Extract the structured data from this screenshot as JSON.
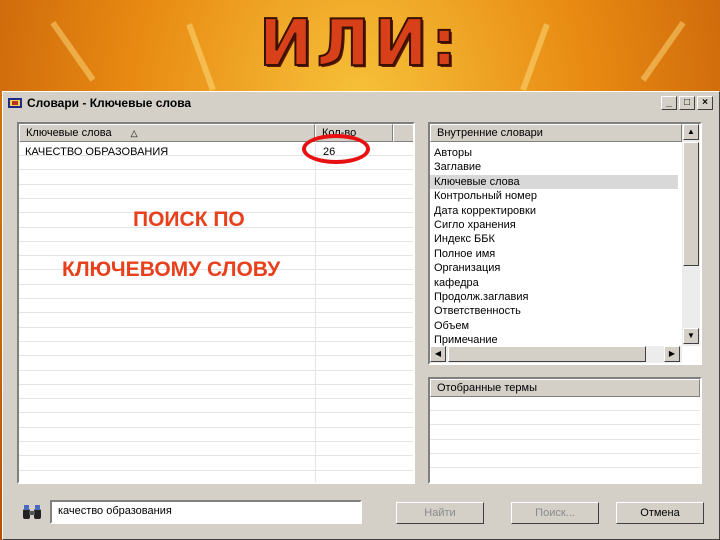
{
  "slide": {
    "title": "ИЛИ:"
  },
  "window": {
    "title": "Словари - Ключевые слова",
    "controls": {
      "minimize": "_",
      "maximize": "□",
      "close": "×"
    }
  },
  "keywords_table": {
    "columns": [
      "Ключевые слова",
      "Кол-во"
    ],
    "sort_indicator": "△",
    "rows": [
      {
        "keyword": "КАЧЕСТВО ОБРАЗОВАНИЯ",
        "count": "26"
      }
    ]
  },
  "dictionaries": {
    "header": "Внутренние словари",
    "items": [
      "Авторы",
      "Заглавие",
      "Ключевые слова",
      "Контрольный номер",
      "Дата корректировки",
      "Сигло хранения",
      "Индекс ББК",
      "Полное имя",
      "Организация",
      "кафедра",
      "Продолж.заглавия",
      "Ответственность",
      "Объем",
      "Примечание"
    ],
    "selected": "Ключевые слова"
  },
  "selected_terms": {
    "header": "Отобранные термы"
  },
  "search": {
    "value": "качество образования"
  },
  "buttons": {
    "find": "Найти",
    "search": "Поиск...",
    "cancel": "Отмена"
  },
  "annotation": {
    "line1": "ПОИСК ПО",
    "line2": "КЛЮЧЕВОМУ СЛОВУ"
  },
  "colors": {
    "annotation": "#e8401c",
    "highlight_circle": "#e81010",
    "selection": "#d8d8d8"
  }
}
